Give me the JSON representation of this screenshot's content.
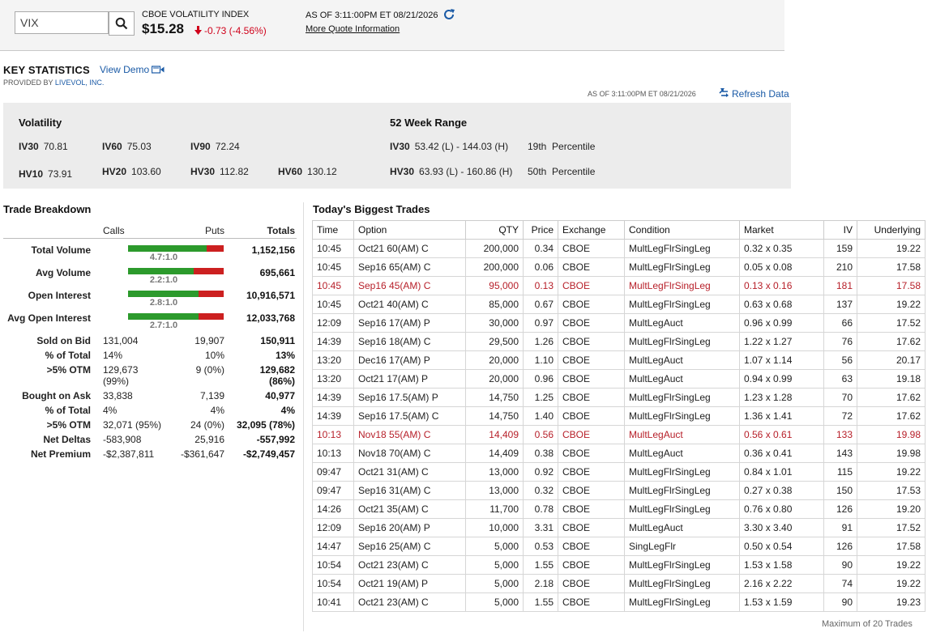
{
  "quote": {
    "symbol_value": "VIX",
    "name": "CBOE VOLATILITY INDEX",
    "price": "$15.28",
    "change": "-0.73 (-4.56%)",
    "as_of": "AS OF 3:11:00PM ET 08/21/2026",
    "more_link": "More Quote Information"
  },
  "key_stats": {
    "title": "KEY STATISTICS",
    "view_demo": "View Demo",
    "provided_prefix": "PROVIDED BY ",
    "provider": "LIVEVOL, INC.",
    "as_of": "AS OF 3:11:00PM ET 08/21/2026",
    "refresh": "Refresh Data"
  },
  "volatility": {
    "title": "Volatility",
    "iv30_l": "IV30",
    "iv30": "70.81",
    "iv60_l": "IV60",
    "iv60": "75.03",
    "iv90_l": "IV90",
    "iv90": "72.24",
    "hv10_l": "HV10",
    "hv10": "73.91",
    "hv20_l": "HV20",
    "hv20": "103.60",
    "hv30_l": "HV30",
    "hv30": "112.82",
    "hv60_l": "HV60",
    "hv60": "130.12"
  },
  "range52": {
    "title": "52 Week Range",
    "r1_l": "IV30",
    "r1": "53.42 (L) - 144.03 (H)",
    "r1_pct": "19th  Percentile",
    "r2_l": "HV30",
    "r2": "63.93 (L) - 160.86 (H)",
    "r2_pct": "50th  Percentile"
  },
  "breakdown": {
    "title": "Trade Breakdown",
    "h_calls": "Calls",
    "h_puts": "Puts",
    "h_totals": "Totals",
    "bars": [
      {
        "label": "Total Volume",
        "ratio": "4.7:1.0",
        "total": "1,152,156",
        "green": 0.82
      },
      {
        "label": "Avg Volume",
        "ratio": "2.2:1.0",
        "total": "695,661",
        "green": 0.69
      },
      {
        "label": "Open Interest",
        "ratio": "2.8:1.0",
        "total": "10,916,571",
        "green": 0.74
      },
      {
        "label": "Avg Open Interest",
        "ratio": "2.7:1.0",
        "total": "12,033,768",
        "green": 0.74
      }
    ],
    "rows": [
      {
        "label": "Sold on Bid",
        "calls": "131,004",
        "puts": "19,907",
        "total": "150,911"
      },
      {
        "label": "% of Total",
        "calls": "14%",
        "puts": "10%",
        "total": "13%"
      },
      {
        "label": ">5% OTM",
        "calls": "129,673",
        "calls2": "(99%)",
        "puts": "9 (0%)",
        "total": "129,682",
        "total2": "(86%)"
      },
      {
        "label": "Bought on Ask",
        "calls": "33,838",
        "puts": "7,139",
        "total": "40,977"
      },
      {
        "label": "% of Total",
        "calls": "4%",
        "puts": "4%",
        "total": "4%"
      },
      {
        "label": ">5% OTM",
        "calls": "32,071 (95%)",
        "puts": "24 (0%)",
        "total": "32,095 (78%)"
      },
      {
        "label": "Net Deltas",
        "calls": "-583,908",
        "puts": "25,916",
        "total": "-557,992"
      },
      {
        "label": "Net Premium",
        "calls": "-$2,387,811",
        "puts": "-$361,647",
        "total": "-$2,749,457"
      }
    ]
  },
  "trades": {
    "title": "Today's Biggest Trades",
    "headers": [
      "Time",
      "Option",
      "QTY",
      "Price",
      "Exchange",
      "Condition",
      "Market",
      "IV",
      "Underlying"
    ],
    "rows": [
      [
        "10:45",
        "Oct21 60(AM) C",
        "200,000",
        "0.34",
        "CBOE",
        "MultLegFlrSingLeg",
        "0.32 x 0.35",
        "159",
        "19.22"
      ],
      [
        "10:45",
        "Sep16 65(AM) C",
        "200,000",
        "0.06",
        "CBOE",
        "MultLegFlrSingLeg",
        "0.05 x 0.08",
        "210",
        "17.58"
      ],
      [
        "10:45",
        "Sep16 45(AM) C",
        "95,000",
        "0.13",
        "CBOE",
        "MultLegFlrSingLeg",
        "0.13 x 0.16",
        "181",
        "17.58"
      ],
      [
        "10:45",
        "Oct21 40(AM) C",
        "85,000",
        "0.67",
        "CBOE",
        "MultLegFlrSingLeg",
        "0.63 x 0.68",
        "137",
        "19.22"
      ],
      [
        "12:09",
        "Sep16 17(AM) P",
        "30,000",
        "0.97",
        "CBOE",
        "MultLegAuct",
        "0.96 x 0.99",
        "66",
        "17.52"
      ],
      [
        "14:39",
        "Sep16 18(AM) C",
        "29,500",
        "1.26",
        "CBOE",
        "MultLegFlrSingLeg",
        "1.22 x 1.27",
        "76",
        "17.62"
      ],
      [
        "13:20",
        "Dec16 17(AM) P",
        "20,000",
        "1.10",
        "CBOE",
        "MultLegAuct",
        "1.07 x 1.14",
        "56",
        "20.17"
      ],
      [
        "13:20",
        "Oct21 17(AM) P",
        "20,000",
        "0.96",
        "CBOE",
        "MultLegAuct",
        "0.94 x 0.99",
        "63",
        "19.18"
      ],
      [
        "14:39",
        "Sep16 17.5(AM) P",
        "14,750",
        "1.25",
        "CBOE",
        "MultLegFlrSingLeg",
        "1.23 x 1.28",
        "70",
        "17.62"
      ],
      [
        "14:39",
        "Sep16 17.5(AM) C",
        "14,750",
        "1.40",
        "CBOE",
        "MultLegFlrSingLeg",
        "1.36 x 1.41",
        "72",
        "17.62"
      ],
      [
        "10:13",
        "Nov18 55(AM) C",
        "14,409",
        "0.56",
        "CBOE",
        "MultLegAuct",
        "0.56 x 0.61",
        "133",
        "19.98"
      ],
      [
        "10:13",
        "Nov18 70(AM) C",
        "14,409",
        "0.38",
        "CBOE",
        "MultLegAuct",
        "0.36 x 0.41",
        "143",
        "19.98"
      ],
      [
        "09:47",
        "Oct21 31(AM) C",
        "13,000",
        "0.92",
        "CBOE",
        "MultLegFlrSingLeg",
        "0.84 x 1.01",
        "115",
        "19.22"
      ],
      [
        "09:47",
        "Sep16 31(AM) C",
        "13,000",
        "0.32",
        "CBOE",
        "MultLegFlrSingLeg",
        "0.27 x 0.38",
        "150",
        "17.53"
      ],
      [
        "14:26",
        "Oct21 35(AM) C",
        "11,700",
        "0.78",
        "CBOE",
        "MultLegFlrSingLeg",
        "0.76 x 0.80",
        "126",
        "19.20"
      ],
      [
        "12:09",
        "Sep16 20(AM) P",
        "10,000",
        "3.31",
        "CBOE",
        "MultLegAuct",
        "3.30 x 3.40",
        "91",
        "17.52"
      ],
      [
        "14:47",
        "Sep16 25(AM) C",
        "5,000",
        "0.53",
        "CBOE",
        "SingLegFlr",
        "0.50 x 0.54",
        "126",
        "17.58"
      ],
      [
        "10:54",
        "Oct21 23(AM) C",
        "5,000",
        "1.55",
        "CBOE",
        "MultLegFlrSingLeg",
        "1.53 x 1.58",
        "90",
        "19.22"
      ],
      [
        "10:54",
        "Oct21 19(AM) P",
        "5,000",
        "2.18",
        "CBOE",
        "MultLegFlrSingLeg",
        "2.16 x 2.22",
        "74",
        "19.22"
      ],
      [
        "10:41",
        "Oct21 23(AM) C",
        "5,000",
        "1.55",
        "CBOE",
        "MultLegFlrSingLeg",
        "1.53 x 1.59",
        "90",
        "19.23"
      ]
    ],
    "highlighted_rows": [
      2,
      10
    ],
    "max_note": "Maximum of 20 Trades"
  },
  "colors": {
    "link": "#1a5aa6",
    "negative": "#d0021b",
    "highlight_row": "#b7202a",
    "bar_green": "#2c9a2c",
    "bar_red": "#cc2020"
  }
}
